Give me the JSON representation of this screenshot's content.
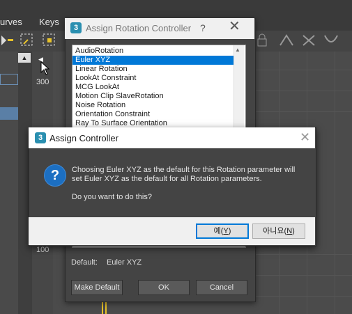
{
  "background_app": {
    "menu": [
      "urves",
      "Keys"
    ],
    "ruler_labels": [
      "300",
      "100"
    ],
    "icons": [
      "key-icon",
      "move-keys-icon",
      "scale-keys-icon",
      "lock-icon",
      "tangent-icon",
      "tangent-fast-icon",
      "tangent-slow-icon"
    ]
  },
  "assign_rotation_dialog": {
    "title": "Assign Rotation Controller",
    "help": "?",
    "close": "✕",
    "logo": "3",
    "controllers": [
      "AudioRotation",
      "Euler XYZ",
      "Linear Rotation",
      "LookAt Constraint",
      "MCG LookAt",
      "Motion Clip SlaveRotation",
      "Noise Rotation",
      "Orientation Constraint",
      "Ray To Surface Orientation"
    ],
    "selected_index": 1,
    "default_label": "Default:",
    "default_value": "Euler XYZ",
    "make_default_label": "Make Default",
    "ok_label": "OK",
    "cancel_label": "Cancel"
  },
  "assign_controller_msgbox": {
    "title": "Assign Controller",
    "logo": "3",
    "close": "✕",
    "icon": "question-icon",
    "message_line1": "Choosing Euler XYZ as the default for this Rotation parameter will",
    "message_line2": "set Euler XYZ as the default for all Rotation parameters.",
    "message_line3": "Do you want to do this?",
    "yes_label": "예(",
    "yes_mnemonic": "Y",
    "yes_suffix": ")",
    "no_label": "아니요(",
    "no_mnemonic": "N",
    "no_suffix": ")"
  },
  "colors": {
    "selection": "#0078d7",
    "dialog_bg": "#444444",
    "question_icon": "#1c6fc2"
  }
}
